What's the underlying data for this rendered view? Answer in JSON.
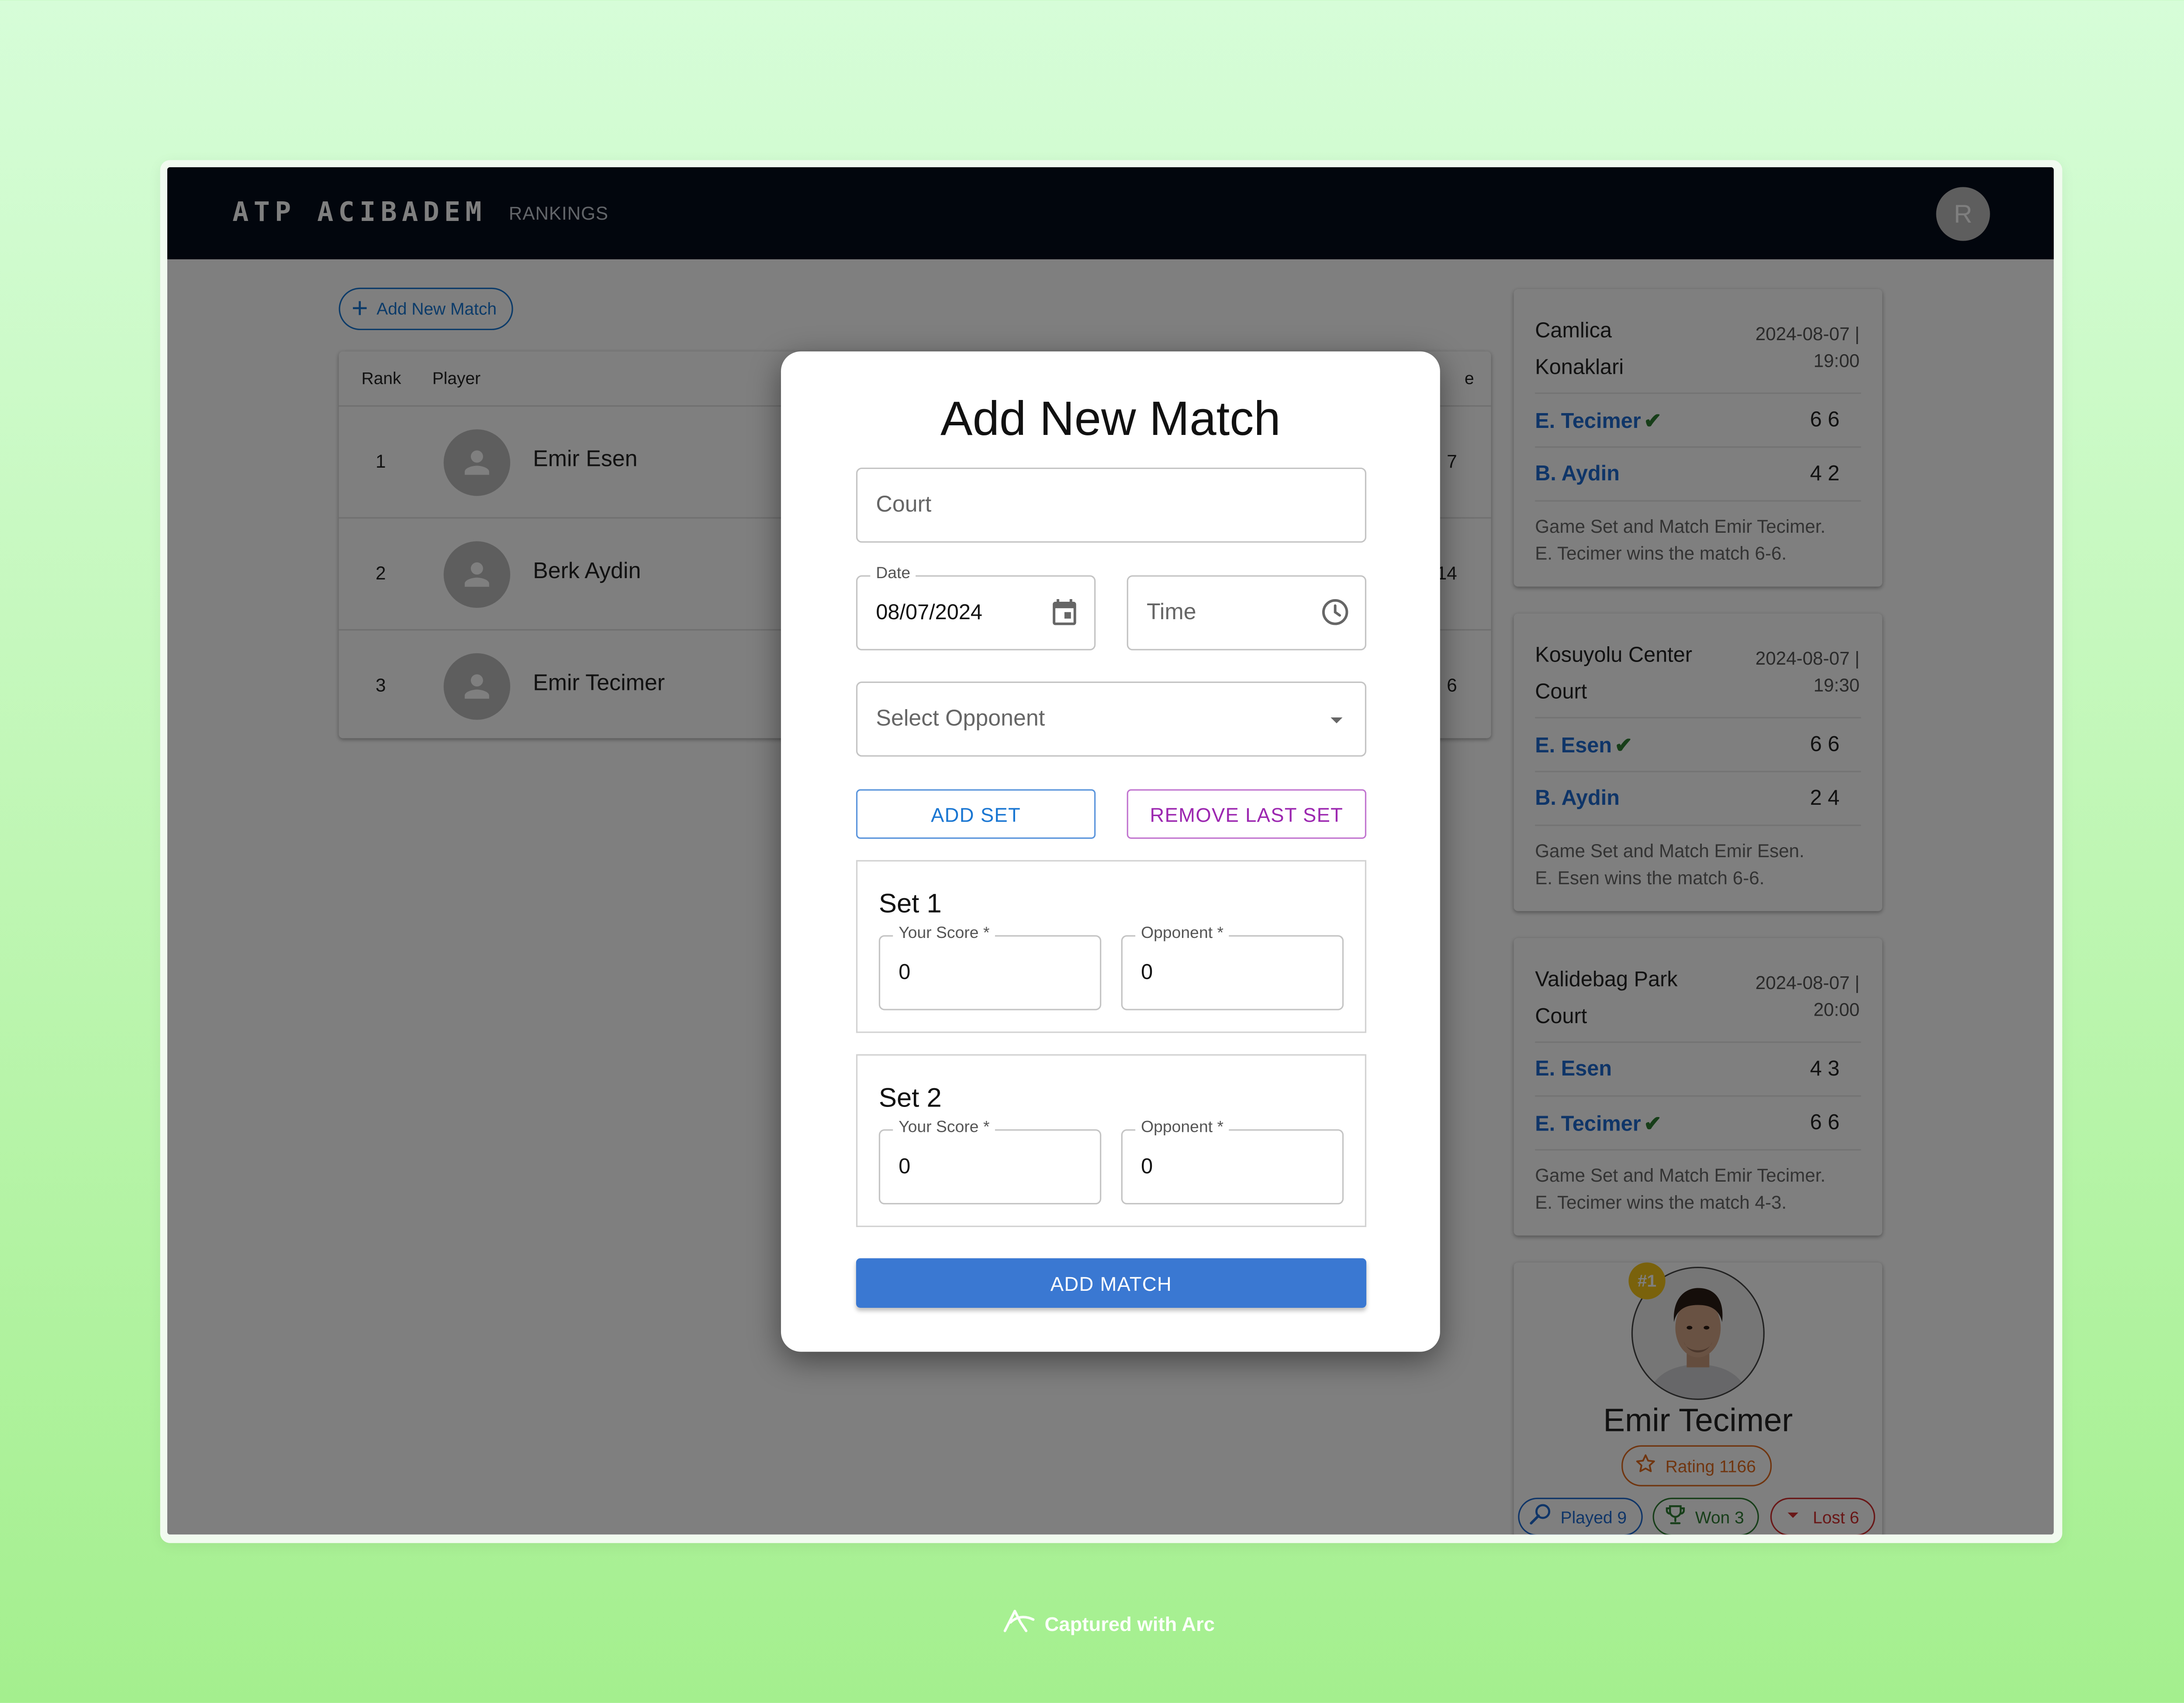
{
  "app": {
    "title": "ATP ACIBADEM",
    "nav_rankings": "RANKINGS",
    "user_initial": "R"
  },
  "toolbar": {
    "add_match_label": "Add New Match"
  },
  "table": {
    "headers": {
      "rank": "Rank",
      "player": "Player",
      "last_partial": "e"
    },
    "rows": [
      {
        "rank": "1",
        "name": "Emir Esen",
        "partial": "7"
      },
      {
        "rank": "2",
        "name": "Berk Aydin",
        "partial": "14"
      },
      {
        "rank": "3",
        "name": "Emir Tecimer",
        "partial": "6"
      }
    ]
  },
  "matches": [
    {
      "court_line1": "Camlica",
      "court_line2": "Konaklari",
      "date": "2024-08-07 |",
      "time": "19:00",
      "p1": "E. Tecimer",
      "p1_check": "✔",
      "p1_score": "6 6",
      "p2": "B. Aydin",
      "p2_check": "",
      "p2_score": "4 2",
      "summary1": "Game Set and Match Emir Tecimer.",
      "summary2": "E. Tecimer wins the match 6-6."
    },
    {
      "court_line1": "Kosuyolu Center",
      "court_line2": "Court",
      "date": "2024-08-07 |",
      "time": "19:30",
      "p1": "E. Esen",
      "p1_check": "✔",
      "p1_score": "6 6",
      "p2": "B. Aydin",
      "p2_check": "",
      "p2_score": "2 4",
      "summary1": "Game Set and Match Emir Esen.",
      "summary2": "E. Esen wins the match 6-6."
    },
    {
      "court_line1": "Validebag Park",
      "court_line2": "Court",
      "date": "2024-08-07 |",
      "time": "20:00",
      "p1": "E. Esen",
      "p1_check": "",
      "p1_score": "4 3",
      "p2": "E. Tecimer",
      "p2_check": "✔",
      "p2_score": "6 6",
      "summary1": "Game Set and Match Emir Tecimer.",
      "summary2": "E. Tecimer wins the match 4-3."
    }
  ],
  "profile": {
    "rank_badge": "#1",
    "name": "Emir Tecimer",
    "rating": "Rating 1166",
    "played": "Played 9",
    "won": "Won 3",
    "lost": "Lost 6",
    "colors": {
      "rating": "#e06a1e",
      "played": "#1e6bd0",
      "won": "#2e7d32",
      "lost": "#d32f2f"
    }
  },
  "modal": {
    "title": "Add New Match",
    "court_placeholder": "Court",
    "date_label": "Date",
    "date_value": "08/07/2024",
    "time_placeholder": "Time",
    "opponent_placeholder": "Select Opponent",
    "add_set_label": "ADD SET",
    "remove_set_label": "REMOVE LAST SET",
    "sets": [
      {
        "title": "Set 1",
        "your_label": "Your Score",
        "opp_label": "Opponent",
        "required": "*",
        "your_value": "0",
        "opp_value": "0"
      },
      {
        "title": "Set 2",
        "your_label": "Your Score",
        "opp_label": "Opponent",
        "required": "*",
        "your_value": "0",
        "opp_value": "0"
      }
    ],
    "submit_label": "ADD MATCH"
  },
  "footer": {
    "captured": "Captured with Arc"
  },
  "icons": [
    "plus-icon",
    "person-icon",
    "calendar-icon",
    "clock-icon",
    "chevron-down-icon",
    "star-icon",
    "racket-icon",
    "trophy-icon",
    "arrow-down-icon",
    "arc-logo-icon"
  ],
  "colors": {
    "primary": "#1976d2",
    "secondary": "#9c27b0",
    "topbar": "#050c1a",
    "link": "#1e6bd0",
    "check": "#2e7d32"
  }
}
